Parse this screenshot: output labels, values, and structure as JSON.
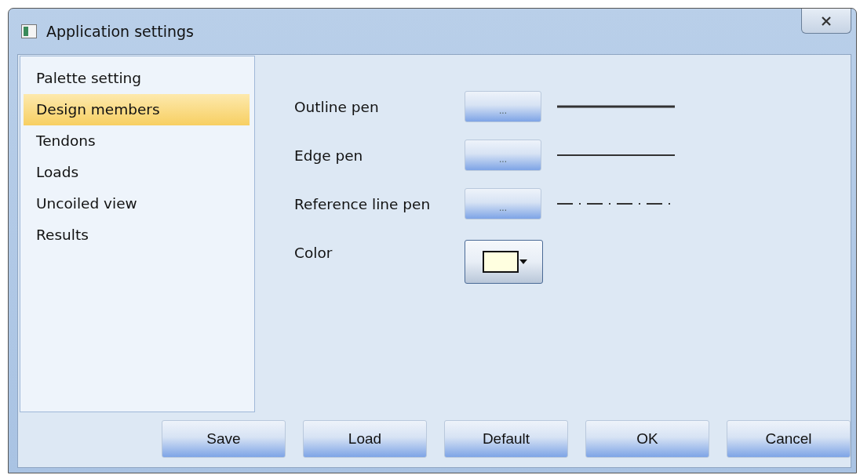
{
  "window": {
    "title": "Application settings"
  },
  "sidebar": {
    "items": [
      {
        "label": "Palette setting",
        "selected": false
      },
      {
        "label": "Design members",
        "selected": true
      },
      {
        "label": "Tendons",
        "selected": false
      },
      {
        "label": "Loads",
        "selected": false
      },
      {
        "label": "Uncoiled view",
        "selected": false
      },
      {
        "label": "Results",
        "selected": false
      }
    ]
  },
  "settings": [
    {
      "kind": "pen",
      "label": "Outline pen",
      "button": "...",
      "line": {
        "kind": "thick"
      }
    },
    {
      "kind": "pen",
      "label": "Edge pen",
      "button": "...",
      "line": {
        "kind": "solid"
      }
    },
    {
      "kind": "pen",
      "label": "Reference line pen",
      "button": "...",
      "line": {
        "kind": "dashdot"
      }
    },
    {
      "kind": "color",
      "label": "Color",
      "color": "#ffffe0"
    }
  ],
  "buttons": [
    "Save",
    "Load",
    "Default",
    "OK",
    "Cancel"
  ]
}
